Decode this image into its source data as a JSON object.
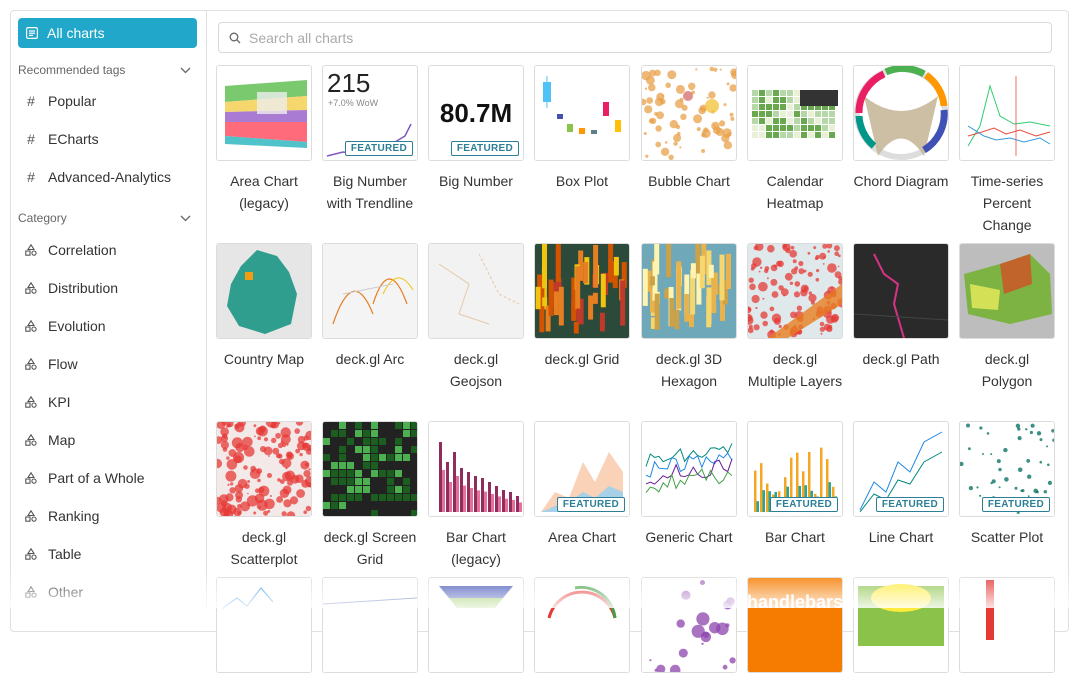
{
  "sidebar": {
    "all_charts": "All charts",
    "recommended_tags": {
      "title": "Recommended tags",
      "items": [
        "Popular",
        "ECharts",
        "Advanced-Analytics"
      ]
    },
    "category": {
      "title": "Category",
      "items": [
        "Correlation",
        "Distribution",
        "Evolution",
        "Flow",
        "KPI",
        "Map",
        "Part of a Whole",
        "Ranking",
        "Table",
        "Other"
      ]
    }
  },
  "search": {
    "placeholder": "Search all charts",
    "value": ""
  },
  "featured_badge": "FEATURED",
  "big_number": {
    "value": "215",
    "delta": "+7.0% WoW",
    "value2": "80.7M"
  },
  "partial_thumb_text": "handlebars",
  "charts": [
    {
      "label": "Area Chart (legacy)",
      "featured": false
    },
    {
      "label": "Big Number with Trendline",
      "featured": true
    },
    {
      "label": "Big Number",
      "featured": true
    },
    {
      "label": "Box Plot",
      "featured": false
    },
    {
      "label": "Bubble Chart",
      "featured": false
    },
    {
      "label": "Calendar Heatmap",
      "featured": false
    },
    {
      "label": "Chord Diagram",
      "featured": false
    },
    {
      "label": "Time-series Percent Change",
      "featured": false
    },
    {
      "label": "Country Map",
      "featured": false
    },
    {
      "label": "deck.gl Arc",
      "featured": false
    },
    {
      "label": "deck.gl Geojson",
      "featured": false
    },
    {
      "label": "deck.gl Grid",
      "featured": false
    },
    {
      "label": "deck.gl 3D Hexagon",
      "featured": false
    },
    {
      "label": "deck.gl Multiple Layers",
      "featured": false
    },
    {
      "label": "deck.gl Path",
      "featured": false
    },
    {
      "label": "deck.gl Polygon",
      "featured": false
    },
    {
      "label": "deck.gl Scatterplot",
      "featured": false
    },
    {
      "label": "deck.gl Screen Grid",
      "featured": false
    },
    {
      "label": "Bar Chart (legacy)",
      "featured": false
    },
    {
      "label": "Area Chart",
      "featured": true
    },
    {
      "label": "Generic Chart",
      "featured": false
    },
    {
      "label": "Bar Chart",
      "featured": true
    },
    {
      "label": "Line Chart",
      "featured": true
    },
    {
      "label": "Scatter Plot",
      "featured": true
    }
  ],
  "colors": {
    "accent": "#20a7c9",
    "badge": "#2d7f97",
    "border": "#e0e0e0"
  }
}
